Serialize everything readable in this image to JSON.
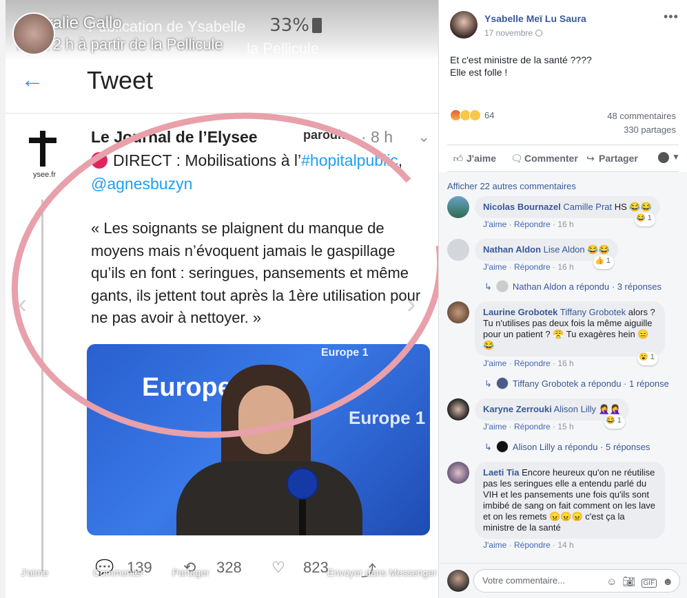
{
  "viewer": {
    "owner_name": "Coralie Gallo",
    "owner_meta": "Il y a 2 h à partir de la Pellicule",
    "ghost_title": "Publication de Ysabelle",
    "ghost_sub": "la Pellicule",
    "status_battery": "33%",
    "screen_title": "Tweet",
    "tweet": {
      "account": "Le Journal de l’Elysee",
      "parody": "parodie",
      "time": "· 8 h",
      "logo_caption": "ysee.fr",
      "direct_prefix": "DIRECT : Mobilisations à l’",
      "hashtag": "#hopitalpublic",
      "comma": ",",
      "handle": "@agnesbuzyn",
      "quote": "« Les soignants se plaignent du manque de moyens mais n’évoquent jamais le gaspillage qu’ils en font : seringues, pansements et même gants, ils jettent tout après la 1ère utilisation pour ne pas avoir à nettoyer. »",
      "image_text_1": "Europe 1",
      "image_text_2": "Europe 1",
      "image_text_3": "Europe 1",
      "replies": "139",
      "retweets": "328",
      "likes": "823"
    },
    "overlay_actions": [
      "J'aime",
      "Commenter",
      "Partager",
      "Envoyer dans Messenger"
    ]
  },
  "post": {
    "author": "Ysabelle Meï Lu Saura",
    "date": "17 novembre",
    "text_line1": "Et c'est ministre de la santé ????",
    "text_line2": "Elle est folle !",
    "reaction_count": "64",
    "comments_count": "48 commentaires",
    "shares_count": "330 partages",
    "actions": {
      "like": "J'aime",
      "comment": "Commenter",
      "share": "Partager"
    },
    "more_comments": "Afficher 22 autres commentaires"
  },
  "comments": [
    {
      "name": "Nicolas Bournazel",
      "tag": "Camille Prat",
      "text": "HS 😂😂",
      "like": "J'aime",
      "reply": "Répondre",
      "time": "16 h",
      "react_count": "1",
      "react_emoji": "😂"
    },
    {
      "name": "Nathan Aldon",
      "tag": "Lise Aldon",
      "text": "😂😂",
      "like": "J'aime",
      "reply": "Répondre",
      "time": "16 h",
      "react_count": "1",
      "react_emoji": "👍",
      "replies": {
        "who": "Nathan Aldon a répondu",
        "count": "3 réponses"
      }
    },
    {
      "name": "Laurine Grobotek",
      "tag": "Tiffany Grobotek",
      "text_l1": "alors ?",
      "text_l2": "Tu n'utilises pas deux fois la même aiguille",
      "text_l3": "pour un patient ? 😤 Tu exagères hein 😑",
      "text_l4": "😂",
      "like": "J'aime",
      "reply": "Répondre",
      "time": "16 h",
      "react_count": "1",
      "react_emoji": "😮",
      "replies": {
        "who": "Tiffany Grobotek a répondu",
        "count": "1 réponse"
      }
    },
    {
      "name": "Karyne Zerrouki",
      "tag": "Alison Lilly",
      "text": "🤦‍♀️🤦‍♀️",
      "like": "J'aime",
      "reply": "Répondre",
      "time": "15 h",
      "react_count": "1",
      "react_emoji": "😂",
      "replies": {
        "who": "Alison Lilly a répondu",
        "count": "5 réponses"
      }
    },
    {
      "name": "Laeti Tia",
      "text_l1": "Encore heureux qu'on ne réutilise",
      "text_l2": "pas les seringues elle a entendu parlé du",
      "text_l3": "VIH et les pansements une fois qu'ils sont",
      "text_l4": "imbibé de sang on fait comment on les lave",
      "text_l5": "et on les remets 😠😠😠 c'est ça la",
      "text_l6": "ministre de la santé",
      "like": "J'aime",
      "reply": "Répondre",
      "time": "14 h"
    }
  ],
  "composer": {
    "placeholder": "Votre commentaire..."
  },
  "colors": {
    "fb_blue": "#385898",
    "twitter_blue": "#1da1f2",
    "circle_red": "#e8a0aa"
  }
}
